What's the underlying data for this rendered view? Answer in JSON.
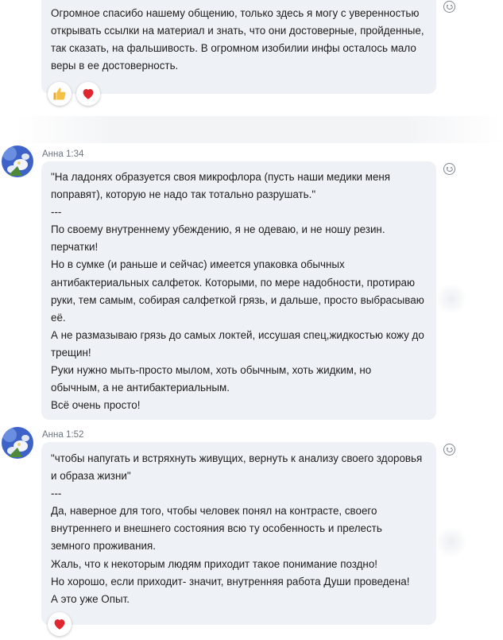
{
  "messages": [
    {
      "lines": [
        "Огромное спасибо нашему общению, только здесь я могу с уверенностью",
        "открывать ссылки на материал и знать, что они достоверные, пройденные,",
        "так сказать, на фальшивость. В огромном изобилии инфы осталось мало",
        "веры в ее достоверность."
      ],
      "reactions": [
        "thumbs-up",
        "heart"
      ]
    },
    {
      "author": "Анна",
      "time": "1:34",
      "lines": [
        "\"На ладонях образуется своя микрофлора (пусть наши медики меня",
        "поправят), которую не надо так тотально разрушать.\"",
        "---",
        "По своему внутреннему убеждению, я не одеваю, и не ношу резин.",
        "перчатки!",
        "Но в сумке (и раньше и сейчас) имеется упаковка обычных",
        "антибактериальных салфеток. Которыми, по мере надобности, протираю",
        "руки, тем самым, собирая салфеткой грязь, и дальше, просто выбрасываю",
        "её.",
        "А не размазываю грязь до самых локтей, иссушая спец,жидкостью кожу до",
        "трещин!",
        "Руки нужно мыть-просто мылом, хоть обычным, хоть жидким, но",
        "обычным, а не  антибактериальным.",
        "Всё очень просто!"
      ]
    },
    {
      "author": "Анна",
      "time": "1:52",
      "lines": [
        "\"чтобы напугать и встряхнуть живущих, вернуть к анализу своего здоровья",
        "и образа жизни\"",
        "---",
        "Да, наверное для того, чтобы человек понял на контрасте, своего",
        "внутреннего и внешнего состояния всю ту особенность и прелесть",
        "земного проживания.",
        "Жаль, что к некоторым людям приходит такое понимание поздно!",
        "Но хорошо, если приходит- значит, внутренняя работа Души проведена!",
        "А это уже Опыт."
      ],
      "reactions": [
        "heart"
      ]
    }
  ],
  "divider": {
    "text": ""
  },
  "colors": {
    "bubble": "#eef1f6",
    "heart": "#e0262f",
    "thumb": "#f5c043",
    "meta": "#6b7480"
  }
}
